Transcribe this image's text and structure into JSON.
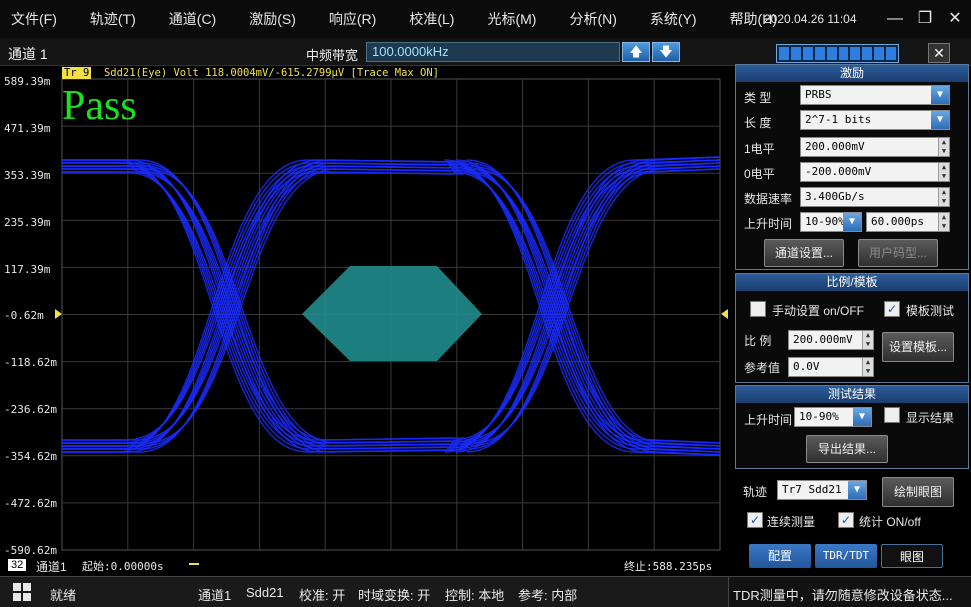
{
  "menu": [
    "文件(F)",
    "轨迹(T)",
    "通道(C)",
    "激励(S)",
    "响应(R)",
    "校准(L)",
    "光标(M)",
    "分析(N)",
    "系统(Y)",
    "帮助(H)"
  ],
  "datetime": "2020.04.26 11:04",
  "window_controls": {
    "minimize": "—",
    "restore": "❐",
    "close": "✕"
  },
  "channel_bar": {
    "title": "通道 1",
    "if_label": "中频带宽",
    "if_value": "100.0000kHz",
    "up": "🡅",
    "down": "🡇",
    "close": "✕"
  },
  "plot": {
    "trace_tag": "Tr 9",
    "trace_text": "Sdd21(Eye) Volt 118.0004mV/-615.2799μV  [Trace Max ON]",
    "pass_text": "Pass",
    "y_labels": [
      "589.39m",
      "471.39m",
      "353.39m",
      "235.39m",
      "117.39m",
      "-0.62m",
      "-118.62m",
      "-236.62m",
      "-354.62m",
      "-472.62m",
      "-590.62m"
    ],
    "channel_num": "32",
    "channel_name": "通道1",
    "start": "起始:0.00000s",
    "stop": "终止:588.235ps",
    "colors": {
      "eye": "#1a2bff",
      "mask": "#1f8c8c",
      "grid": "#3a3a3a",
      "pass": "#1fe01f"
    }
  },
  "stimulus": {
    "title": "激励",
    "type_label": "类 型",
    "type_value": "PRBS",
    "length_label": "长 度",
    "length_value": "2^7-1 bits",
    "one_level_label": "1电平",
    "one_level_value": "200.000mV",
    "zero_level_label": "0电平",
    "zero_level_value": "-200.000mV",
    "rate_label": "数据速率",
    "rate_value": "3.400Gb/s",
    "rise_label": "上升时间",
    "rise_mode": "10-90%",
    "rise_value": "60.000ps",
    "channel_settings_btn": "通道设置...",
    "user_pattern_btn": "用户码型..."
  },
  "scale": {
    "title": "比例/模板",
    "manual_label": "手动设置 on/OFF",
    "mask_test_label": "模板测试",
    "ratio_label": "比 例",
    "ratio_value": "200.000mV",
    "ref_label": "参考值",
    "ref_value": "0.0V",
    "set_mask_btn": "设置模板..."
  },
  "results": {
    "title": "测试结果",
    "rise_label": "上升时间",
    "rise_mode": "10-90%",
    "show_label": "显示结果",
    "export_btn": "导出结果..."
  },
  "trace": {
    "label": "轨迹",
    "value": "Tr7 Sdd21",
    "draw_eye_btn": "绘制眼图",
    "continuous_label": "连续测量",
    "stats_label": "统计 ON/off"
  },
  "tabs": [
    "配置",
    "TDR/TDT",
    "眼图"
  ],
  "statusbar": {
    "ready": "就绪",
    "channel": "通道1",
    "param": "Sdd21",
    "cal": "校准: 开",
    "time_domain": "时域变换: 开",
    "control": "控制: 本地",
    "ref": "参考: 内部",
    "tdr_msg": "TDR测量中，请勿随意修改设备状态..."
  }
}
